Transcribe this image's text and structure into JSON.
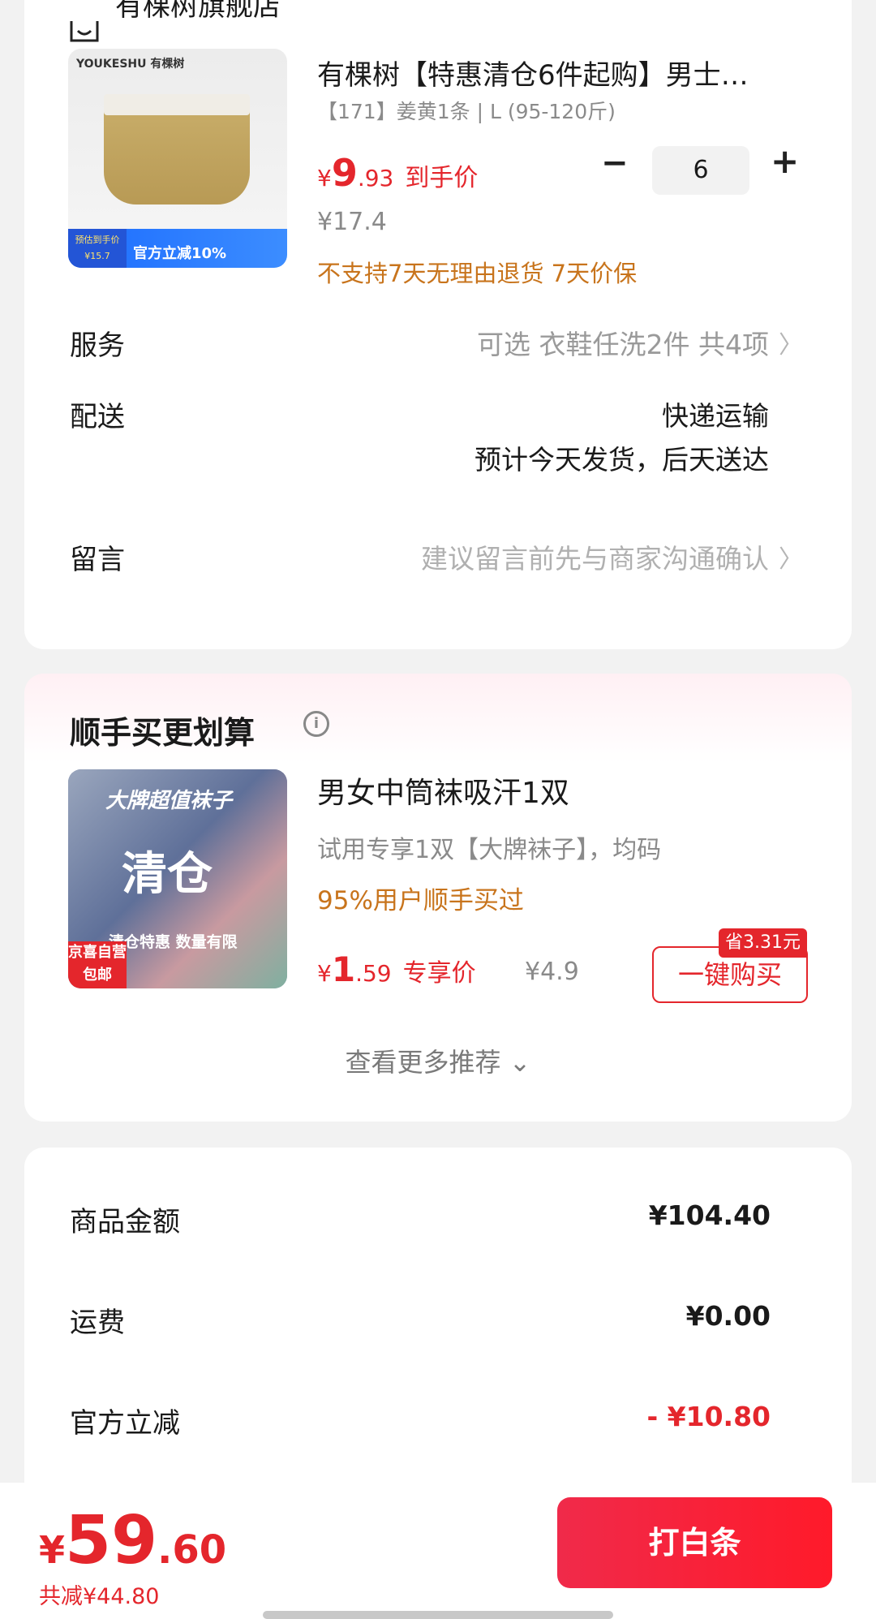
{
  "store": {
    "name": "有棵树旗舰店",
    "icon": "store-icon"
  },
  "product": {
    "thumb_brand": "YOUKESHU 有棵树",
    "thumb_promo": "官方立减10%",
    "thumb_promo_tag": "预估到手价 ¥15.7",
    "title": "有棵树【特惠清仓6件起购】男士…",
    "spec": "【171】姜黄1条 | L (95-120斤)",
    "price_currency": "¥",
    "price_int": "9",
    "price_dec": ".93",
    "price_label": "到手价",
    "original_price": "¥17.4",
    "policy": "不支持7天无理由退货  7天价保",
    "quantity": "6"
  },
  "rows": {
    "service_label": "服务",
    "service_value": "可选  衣鞋任洗2件  共4项",
    "delivery_label": "配送",
    "delivery_method": "快递运输",
    "delivery_eta": "预计今天发货，后天送达",
    "note_label": "留言",
    "note_placeholder": "建议留言前先与商家沟通确认"
  },
  "recommend": {
    "title": "顺手买更划算",
    "thumb_top": "大牌超值袜子",
    "thumb_mid": "清仓",
    "thumb_bot": "清仓特惠 数量有限",
    "thumb_badge": "京喜自营 包邮",
    "item_title": "男女中筒袜吸汗1双",
    "item_spec": "试用专享1双【大牌袜子】，均码",
    "item_bought": "95%用户顺手买过",
    "price_currency": "¥",
    "price_int": "1",
    "price_dec": ".59",
    "price_label": "专享价",
    "original_price": "¥4.9",
    "save_tag": "省3.31元",
    "buy_label": "一键购买",
    "more_label": "查看更多推荐 ⌄"
  },
  "summary": {
    "goods_label": "商品金额",
    "goods_value": "¥104.40",
    "shipping_label": "运费",
    "shipping_value": "¥0.00",
    "discount_label": "官方立减",
    "discount_value": "- ¥10.80"
  },
  "footer": {
    "currency": "¥",
    "total_int": "59",
    "total_dec": ".60",
    "saved": "共减¥44.80",
    "pay_label": "打白条"
  },
  "colors": {
    "accent": "#e4262c",
    "orange": "#c8741c"
  }
}
